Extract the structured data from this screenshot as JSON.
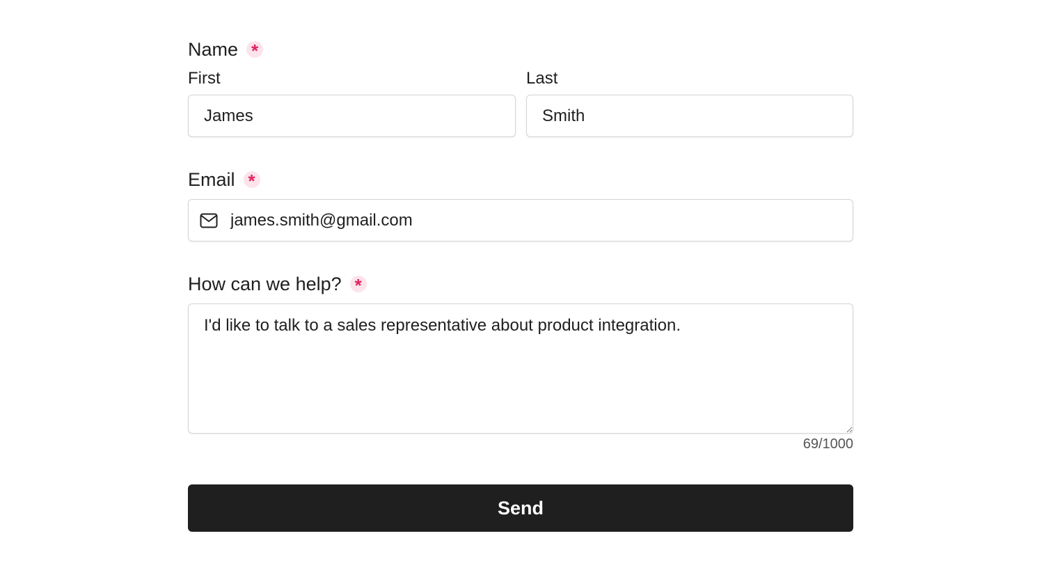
{
  "name_section": {
    "label": "Name",
    "required_marker": "*",
    "first": {
      "label": "First",
      "value": "James"
    },
    "last": {
      "label": "Last",
      "value": "Smith"
    }
  },
  "email_section": {
    "label": "Email",
    "required_marker": "*",
    "icon": "mail-icon",
    "value": "james.smith@gmail.com"
  },
  "help_section": {
    "label": "How can we help?",
    "required_marker": "*",
    "value": "I'd like to talk to a sales representative about product integration.",
    "counter": "69/1000"
  },
  "send_button": {
    "label": "Send"
  },
  "colors": {
    "required_accent": "#e0245e",
    "required_bg": "#fde3ec",
    "button_bg": "#1f1f1f",
    "field_border": "#d4d4d8"
  }
}
